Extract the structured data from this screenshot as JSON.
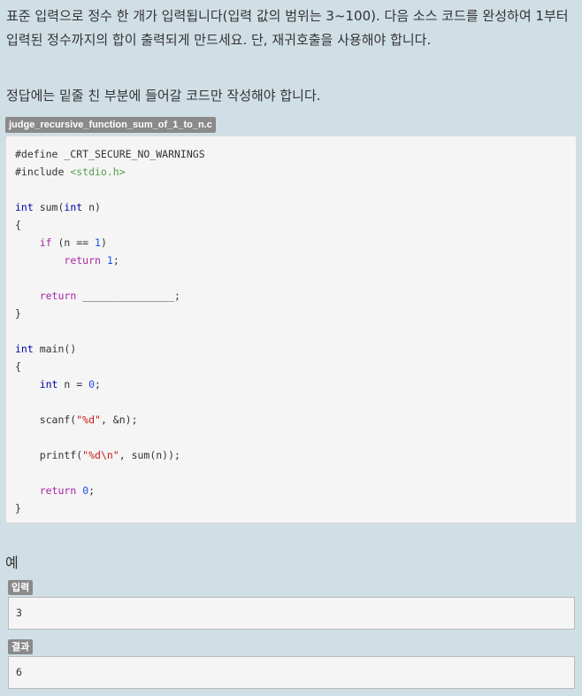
{
  "problem": {
    "description": "표준 입력으로 정수 한 개가 입력됩니다(입력 값의 범위는 3~100). 다음 소스 코드를 완성하여 1부터 입력된 정수까지의 합이 출력되게 만드세요. 단, 재귀호출을 사용해야 합니다.",
    "instruction": "정답에는 밑줄 친 부분에 들어갈 코드만 작성해야 합니다."
  },
  "code": {
    "filename": "judge_recursive_function_sum_of_1_to_n.c",
    "lines": [
      "#define _CRT_SECURE_NO_WARNINGS",
      "#include <stdio.h>",
      "",
      "int sum(int n)",
      "{",
      "    if (n == 1)",
      "        return 1;",
      "",
      "    return _______________;",
      "}",
      "",
      "int main()",
      "{",
      "    int n = 0;",
      "",
      "    scanf(\"%d\", &n);",
      "",
      "    printf(\"%d\\n\", sum(n));",
      "",
      "    return 0;",
      "}"
    ]
  },
  "example": {
    "heading": "예",
    "input_label": "입력",
    "input_value": "3",
    "output_label": "결과",
    "output_value": "6"
  }
}
